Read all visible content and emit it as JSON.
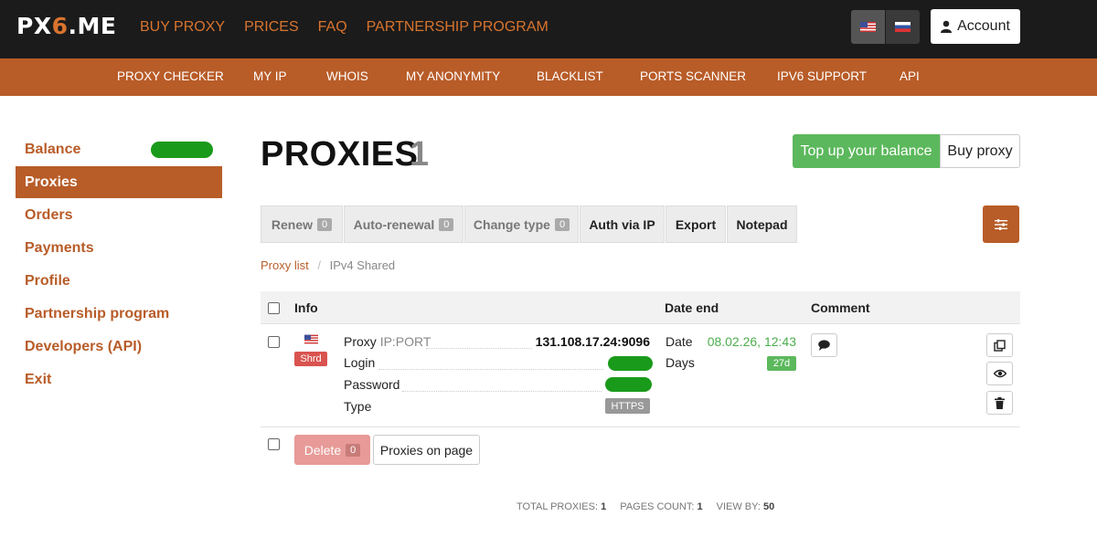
{
  "brand": {
    "logo_part1": "PX",
    "logo_part2": "6",
    "logo_part3": ".ME"
  },
  "top_nav": [
    "BUY PROXY",
    "PRICES",
    "FAQ",
    "PARTNERSHIP PROGRAM"
  ],
  "languages": [
    {
      "code": "en",
      "icon": "us-flag-icon"
    },
    {
      "code": "ru",
      "icon": "ru-flag-icon"
    }
  ],
  "account": {
    "label": "Account",
    "icon": "user-icon"
  },
  "sub_nav": [
    "PROXY CHECKER",
    "MY IP",
    "WHOIS",
    "MY ANONYMITY",
    "BLACKLIST",
    "PORTS SCANNER",
    "IPV6 SUPPORT",
    "API"
  ],
  "sidebar": {
    "items": [
      {
        "label": "Balance",
        "active": false
      },
      {
        "label": "Proxies",
        "active": true
      },
      {
        "label": "Orders",
        "active": false
      },
      {
        "label": "Payments",
        "active": false
      },
      {
        "label": "Profile",
        "active": false
      },
      {
        "label": "Partnership program",
        "active": false
      },
      {
        "label": "Developers (API)",
        "active": false
      },
      {
        "label": "Exit",
        "active": false
      }
    ]
  },
  "page": {
    "title": "PROXIES",
    "count": "1"
  },
  "actions": {
    "topup": "Top up your balance",
    "buy": "Buy proxy"
  },
  "toolbar": {
    "renew": "Renew",
    "renew_count": "0",
    "autorenew": "Auto-renewal",
    "autorenew_count": "0",
    "change_type": "Change type",
    "change_type_count": "0",
    "auth_ip": "Auth via IP",
    "export": "Export",
    "notepad": "Notepad",
    "settings_icon": "sliders-icon"
  },
  "breadcrumb": {
    "link": "Proxy list",
    "separator": "/",
    "current": "IPv4 Shared"
  },
  "table": {
    "headers": {
      "info": "Info",
      "date_end": "Date end",
      "comment": "Comment"
    },
    "row": {
      "badge": "Shrd",
      "flag": "us-flag-icon",
      "proxy_label": "Proxy",
      "proxy_hint": "IP:PORT",
      "proxy_value": "131.108.17.24:9096",
      "login_label": "Login",
      "password_label": "Password",
      "type_label": "Type",
      "type_value": "HTTPS",
      "date_label": "Date",
      "date_value": "08.02.26, 12:43",
      "days_label": "Days",
      "days_value": "27d"
    }
  },
  "bulk": {
    "delete": "Delete",
    "delete_count": "0",
    "per_page": "Proxies on page"
  },
  "footer": {
    "total_label": "TOTAL PROXIES:",
    "total_value": "1",
    "pages_label": "PAGES COUNT:",
    "pages_value": "1",
    "view_label": "VIEW BY:",
    "view_value": "50"
  },
  "colors": {
    "brand_orange": "#b85c28",
    "accent_orange": "#d9742e",
    "success_green": "#5cb85c",
    "danger_red": "#d9534f"
  }
}
